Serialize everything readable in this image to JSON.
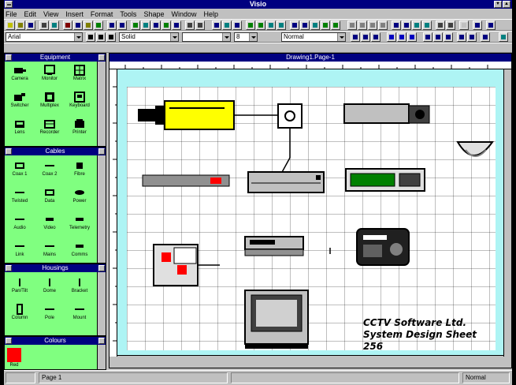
{
  "app": {
    "title": "Visio"
  },
  "menu": [
    "File",
    "Edit",
    "View",
    "Insert",
    "Format",
    "Tools",
    "Shape",
    "Window",
    "Help"
  ],
  "toolbar2": {
    "font_name": "Arial",
    "font_size": "8",
    "line_style": "Solid"
  },
  "toolbar3": {
    "zoom": "Normal"
  },
  "stencils": [
    {
      "title": "Equipment",
      "items": [
        "Camera",
        "Monitor",
        "Matrix",
        "Switcher",
        "Multiplex",
        "Keyboard",
        "Lens",
        "Recorder",
        "Printer"
      ]
    },
    {
      "title": "Cables",
      "items": [
        "Coax 1",
        "Coax 2",
        "Fibre",
        "Twisted",
        "Data",
        "Power",
        "Audio",
        "Video",
        "Telemetry",
        "Link",
        "Mains",
        "Comms"
      ]
    },
    {
      "title": "Housings",
      "items": [
        "Pan/Tilt",
        "Dome",
        "Bracket",
        "Column",
        "Pole",
        "Mount"
      ]
    },
    {
      "title": "Colours",
      "items": [
        "Red"
      ]
    }
  ],
  "document": {
    "title": "Drawing1.Page-1",
    "caption_line1": "CCTV Software Ltd.",
    "caption_line2": "System Design Sheet 256"
  },
  "status": {
    "left": "",
    "page": "Page 1",
    "right": "Normal"
  },
  "colors": {
    "accent": "#000080",
    "stencil_bg": "#80ff80",
    "canvas_bg": "#aef4f4",
    "swatch": "#ff0000",
    "camera_housing": "#ffff00"
  }
}
